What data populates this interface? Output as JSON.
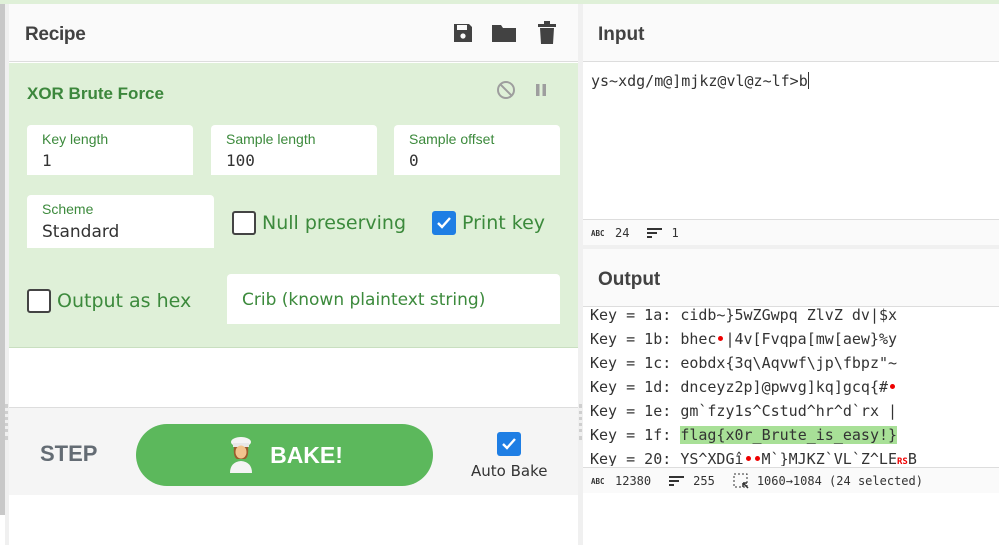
{
  "recipe": {
    "title": "Recipe",
    "header_icons": [
      "save-icon",
      "folder-icon",
      "trash-icon"
    ],
    "operation": {
      "name": "XOR Brute Force",
      "controls": [
        "disable-icon",
        "pause-icon"
      ],
      "fields": {
        "key_length": {
          "label": "Key length",
          "value": "1"
        },
        "sample_length": {
          "label": "Sample length",
          "value": "100"
        },
        "sample_offset": {
          "label": "Sample offset",
          "value": "0"
        },
        "scheme": {
          "label": "Scheme",
          "value": "Standard"
        }
      },
      "checkboxes": {
        "null_preserving": {
          "label": "Null preserving",
          "checked": false
        },
        "print_key": {
          "label": "Print key",
          "checked": true
        },
        "output_as_hex": {
          "label": "Output as hex",
          "checked": false
        }
      },
      "crib": {
        "placeholder": "Crib (known plaintext string)",
        "value": ""
      }
    },
    "controls": {
      "step_label": "STEP",
      "bake_label": "BAKE!",
      "auto_bake_label": "Auto Bake",
      "auto_bake_checked": true
    }
  },
  "input": {
    "title": "Input",
    "text": "ys~xdg/m@]mjkz@vl@z~lf>b",
    "status": {
      "length": "24",
      "lines": "1"
    }
  },
  "output": {
    "title": "Output",
    "lines": [
      {
        "prefix": "Key = 1a: ",
        "text": "cidb~}5wZGwpq ZlvZ dv|$x"
      },
      {
        "prefix": "Key = 1b: ",
        "pre": "bhec",
        "ctrl": "dot",
        "text": "|4v[Fvqpa[mw[aew}%y"
      },
      {
        "prefix": "Key = 1c: ",
        "text": "eobdx{3q\\Aqvwf\\jp\\fbpz\"~"
      },
      {
        "prefix": "Key = 1d: ",
        "text": "dnceyz2p]@pwvg]kq]gcq{#",
        "ctrl_end": "dot"
      },
      {
        "prefix": "Key = 1e: ",
        "text": "gm`fzy1s^Cstud^hr^d`rx |"
      },
      {
        "prefix": "Key = 1f: ",
        "text": "flag{x0r_Brute_is_easy!}",
        "highlighted": true
      },
      {
        "prefix": "Key = 20: ",
        "pre": "YS^XDGî",
        "ctrl": "dot-dot",
        "text": "M`}MJKZ`VL`Z^LE",
        "rs": "RS",
        "post": "B"
      }
    ],
    "status": {
      "length": "12380",
      "lines": "255",
      "selection": "1060→1084 (24 selected)"
    }
  }
}
